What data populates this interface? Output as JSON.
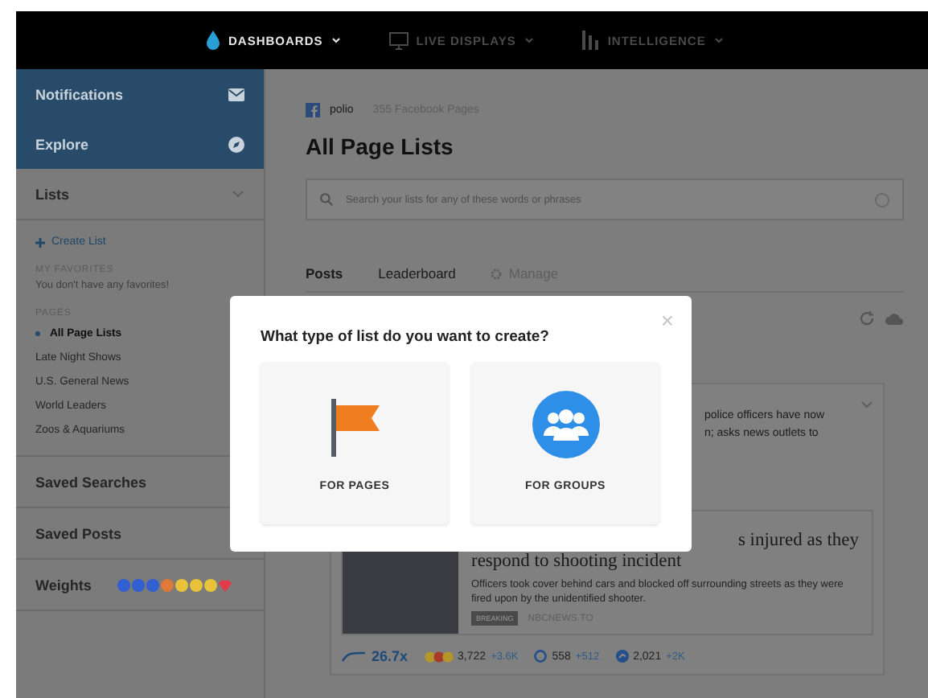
{
  "top_nav": [
    {
      "label": "DASHBOARDS",
      "selected": true
    },
    {
      "label": "LIVE DISPLAYS",
      "selected": false
    },
    {
      "label": "INTELLIGENCE",
      "selected": false
    }
  ],
  "sidebar": {
    "primary": [
      {
        "label": "Notifications"
      },
      {
        "label": "Explore"
      }
    ],
    "lists": {
      "label": "Lists",
      "expanded": true,
      "create": "Create List",
      "favorites": {
        "heading": "MY FAVORITES",
        "empty": "You don't have any favorites!"
      },
      "pages": {
        "heading": "PAGES",
        "items": [
          {
            "label": "All Page Lists",
            "selected": true
          },
          {
            "label": "Late Night Shows",
            "selected": false
          },
          {
            "label": "U.S. General News",
            "selected": false
          },
          {
            "label": "World Leaders",
            "selected": false
          },
          {
            "label": "Zoos & Aquariums",
            "selected": false
          }
        ]
      }
    },
    "rows": [
      "Saved Searches",
      "Saved Posts"
    ],
    "weights": {
      "label": "Weights"
    }
  },
  "main": {
    "breadcrumb": {
      "account": "polio",
      "count": "355 Facebook Pages"
    },
    "title": "All Page Lists",
    "search": {
      "placeholder": "Search your lists for any of these words or phrases"
    },
    "tabs": [
      {
        "label": "Posts",
        "selected": true,
        "disabled": false
      },
      {
        "label": "Leaderboard",
        "selected": false,
        "disabled": false
      },
      {
        "label": "Manage",
        "selected": false,
        "disabled": true
      }
    ],
    "post": {
      "snippet": [
        "police officers have now",
        "n; asks news outlets to"
      ],
      "link": {
        "headline": [
          "s injured as they",
          "respond to shooting incident"
        ],
        "description": "Officers took cover behind cars and blocked off surrounding streets as they were fired upon by the unidentified shooter.",
        "badge": "BREAKING",
        "source": "NBCNEWS.TO"
      },
      "stats": {
        "trend": "26.7x",
        "reactions": "3,722",
        "reactions_delta": "+3.6K",
        "comments": "558",
        "comments_delta": "+512",
        "shares": "2,021",
        "shares_delta": "+2K"
      }
    }
  },
  "modal": {
    "title": "What type of list do you want to create?",
    "close": "×",
    "options": [
      {
        "label": "FOR PAGES"
      },
      {
        "label": "FOR GROUPS"
      }
    ]
  }
}
